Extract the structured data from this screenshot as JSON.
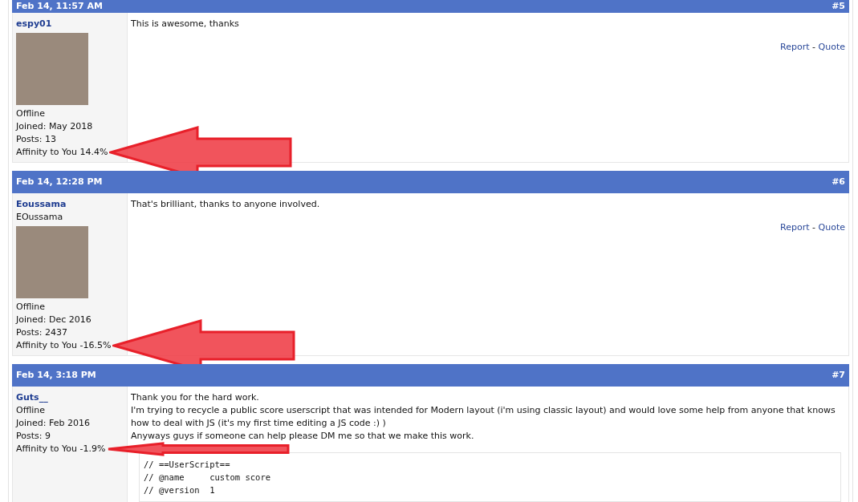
{
  "posts": [
    {
      "date": "Feb 14, 11:57 AM",
      "number": "#5",
      "author": "espy01",
      "avatar": true,
      "status": "Offline",
      "joined": "Joined: May 2018",
      "posts": "Posts: 13",
      "affinity": "Affinity to You 14.4%",
      "highlight_arrow": true,
      "body": [
        "This is awesome, thanks"
      ],
      "actions": [
        "Report",
        "Quote"
      ],
      "separator": "-"
    },
    {
      "date": "Feb 14, 12:28 PM",
      "number": "#6",
      "author": "Eoussama",
      "user_title": "EOussama",
      "avatar": true,
      "status": "Offline",
      "joined": "Joined: Dec 2016",
      "posts": "Posts: 2437",
      "affinity": "Affinity to You -16.5%",
      "highlight_arrow": true,
      "body": [
        "That's brilliant, thanks to anyone involved."
      ],
      "actions": [
        "Report",
        "Quote"
      ],
      "separator": "-"
    },
    {
      "date": "Feb 14, 3:18 PM",
      "number": "#7",
      "author": "Guts__",
      "avatar": false,
      "status": "Offline",
      "joined": "Joined: Feb 2016",
      "posts": "Posts: 9",
      "affinity": "Affinity to You -1.9%",
      "highlight_arrow": true,
      "body": [
        "Thank you for the hard work.",
        "I'm trying to recycle a public score userscript that was intended for Modern layout (i'm using classic layout) and would love some help from anyone that knows how to deal with JS (it's my first time editing a JS code :) )",
        "Anyways guys if someone can help please DM me so that we make this work."
      ],
      "code": [
        "// ==UserScript==",
        "// @name     custom score",
        "// @version  1"
      ]
    }
  ]
}
